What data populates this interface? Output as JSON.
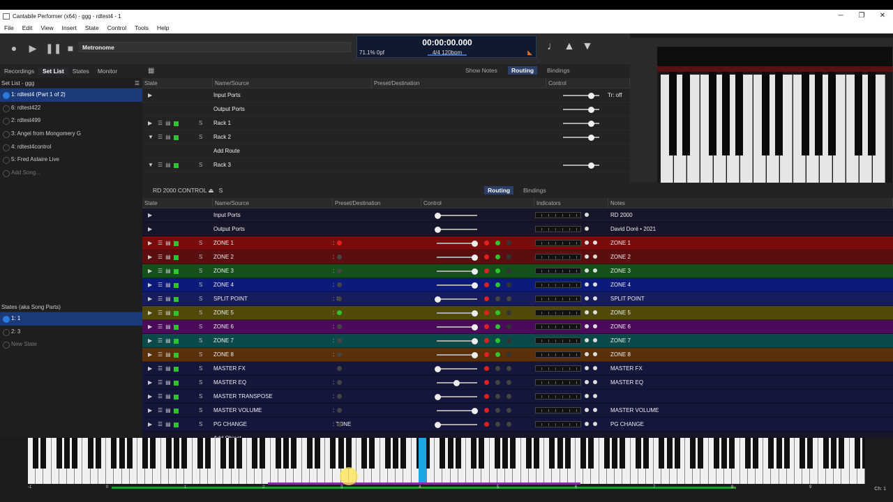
{
  "window": {
    "title": "Cantabile Performer (x64) - ggg - rdtest4 - 1",
    "controls": [
      "─",
      "❐",
      "✕"
    ]
  },
  "menu": [
    "File",
    "Edit",
    "View",
    "Insert",
    "State",
    "Control",
    "Tools",
    "Help"
  ],
  "toolbar": {
    "metronome_label": "Metronome",
    "time": "00:00:00.000",
    "load": "71.1%  0pf",
    "tempo": "4/4 120bpm"
  },
  "sidebar": {
    "tabs": [
      "Recordings",
      "Set List",
      "States",
      "Monitor"
    ],
    "active_tab": "Set List",
    "setlist_header": "Set List - ggg",
    "songs": [
      "1: rdtest4 (Part 1 of 2)",
      "6: rdtest422",
      "2: rdtest499",
      "3: Angel from Mongomery G",
      "4: rdtest4control",
      "5: Fred Astaire Live"
    ],
    "add_song": "Add Song...",
    "states_header": "States (aka Song Parts)",
    "states": [
      "1: 1",
      "2: 3"
    ],
    "new_state": "New State"
  },
  "main": {
    "tabs": [
      "Show Notes",
      "Routing",
      "Bindings"
    ],
    "columns": [
      "State",
      "Name/Source",
      "Preset/Destination",
      "Control"
    ],
    "rows": [
      {
        "name": "Input Ports",
        "control": "Tr: off"
      },
      {
        "name": "Output Ports",
        "control": ""
      },
      {
        "name": "Rack 1",
        "s": "S",
        "control": ""
      },
      {
        "name": "Rack 2",
        "s": "S",
        "control": ""
      },
      {
        "name": "Add Route",
        "control": ""
      },
      {
        "name": "Rack 3",
        "s": "S",
        "control": ""
      }
    ]
  },
  "rack": {
    "title": "RD 2000 CONTROL",
    "s": "S",
    "tabs": [
      "Routing",
      "Bindings"
    ],
    "columns": [
      "State",
      "Name/Source",
      "Preset/Destination",
      "Control",
      "Indicators",
      "Notes"
    ],
    "rows": [
      {
        "name": "Input Ports",
        "preset": "",
        "note": "RD 2000"
      },
      {
        "name": "Output Ports",
        "preset": "",
        "note": "David Doré  •  2021"
      },
      {
        "name": "ZONE 1",
        "preset": ":",
        "note": "ZONE 1",
        "bg": "#7a0c0c"
      },
      {
        "name": "ZONE 2",
        "preset": ":",
        "note": "ZONE 2",
        "bg": "#5a0e10"
      },
      {
        "name": "ZONE 3",
        "preset": ":",
        "note": "ZONE 3",
        "bg": "#14501a"
      },
      {
        "name": "ZONE 4",
        "preset": ":",
        "note": "ZONE 4",
        "bg": "#0c1a7a"
      },
      {
        "name": "SPLIT POINT",
        "preset": ": ✕",
        "note": "SPLIT POINT",
        "bg": "#161c5c"
      },
      {
        "name": "ZONE 5",
        "preset": ":",
        "note": "ZONE 5",
        "bg": "#4f4a0a"
      },
      {
        "name": "ZONE 6",
        "preset": ":",
        "note": "ZONE 6",
        "bg": "#4a0c5a"
      },
      {
        "name": "ZONE 7",
        "preset": ":",
        "note": "ZONE 7",
        "bg": "#0c4a4a"
      },
      {
        "name": "ZONE 8",
        "preset": ":",
        "note": "ZONE 8",
        "bg": "#5a300a"
      },
      {
        "name": "MASTER FX",
        "preset": "",
        "note": "MASTER FX",
        "bg": "#14163c"
      },
      {
        "name": "MASTER EQ",
        "preset": ":",
        "note": "MASTER EQ",
        "bg": "#14163c"
      },
      {
        "name": "MASTER TRANSPOSE",
        "preset": ":",
        "note": "",
        "bg": "#14163c"
      },
      {
        "name": "MASTER VOLUME",
        "preset": ":",
        "note": "MASTER VOLUME",
        "bg": "#14163c"
      },
      {
        "name": "PG CHANGE",
        "preset": ": TONE",
        "note": "PG CHANGE",
        "bg": "#14163c"
      },
      {
        "name": "Add Object",
        "preset": "",
        "note": ""
      }
    ]
  },
  "keyboard": {
    "ruler": [
      "-1",
      "0",
      "1",
      "2",
      "3",
      "4",
      "5",
      "6",
      "7",
      "8",
      "9"
    ],
    "channel": "Ch: 1"
  },
  "colors": {
    "accent": "#2c3f66",
    "selected": "#1a3a78",
    "highlight_key": "#1aa7e8"
  }
}
